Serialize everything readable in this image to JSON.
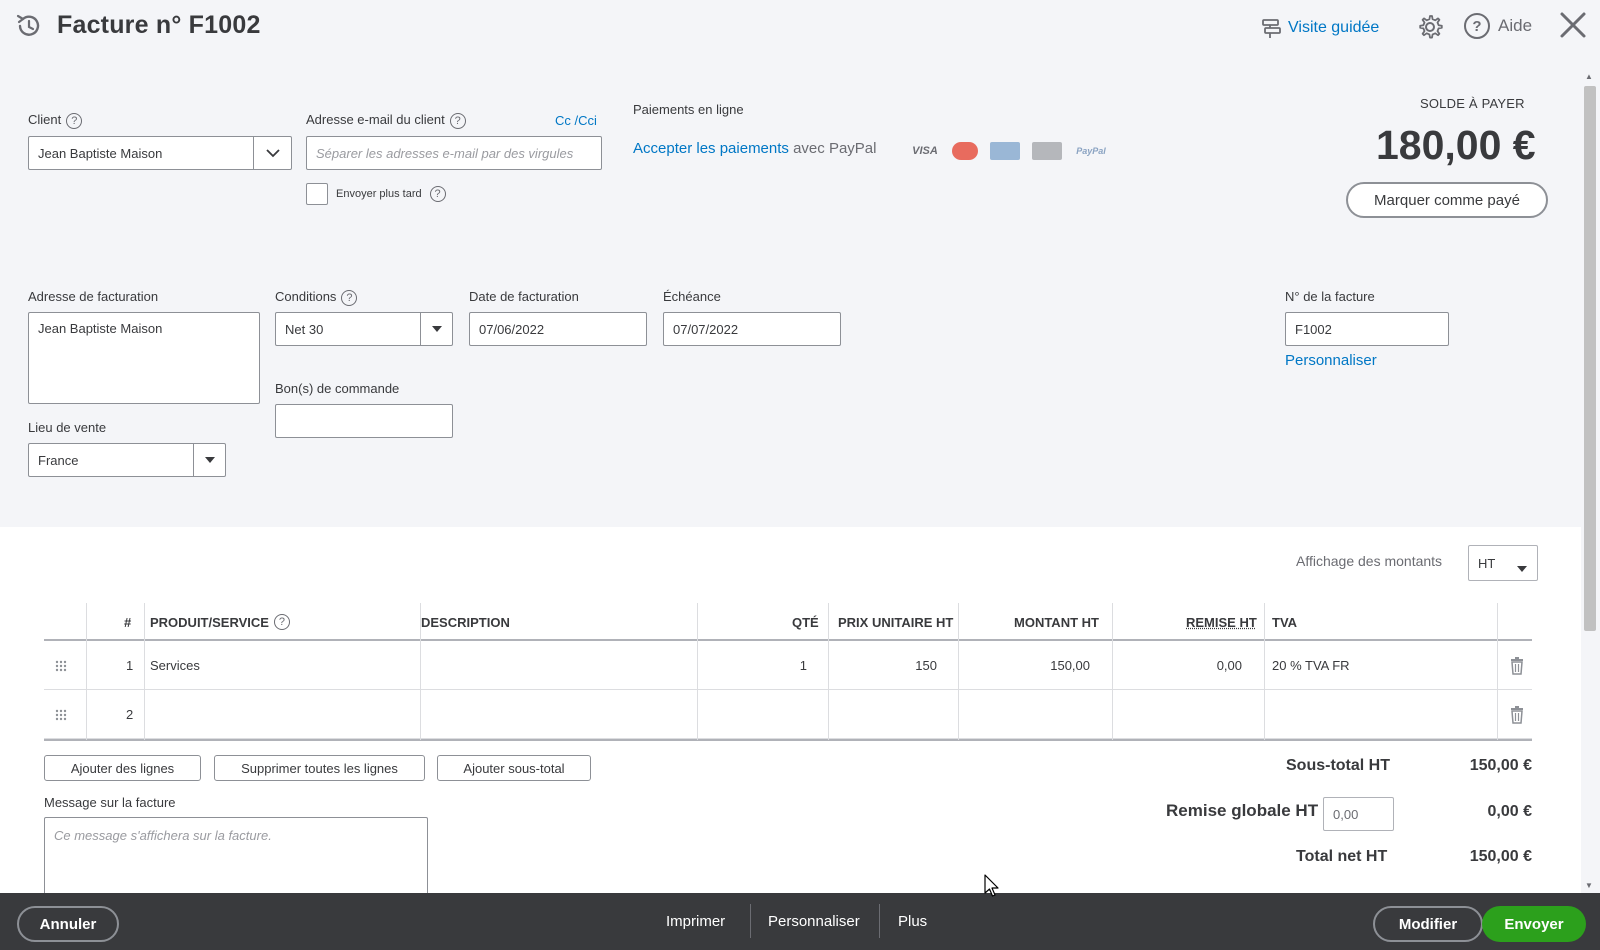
{
  "header": {
    "title": "Facture n° F1002",
    "guided_tour": "Visite guidée",
    "help": "Aide"
  },
  "client": {
    "label": "Client",
    "value": "Jean Baptiste Maison"
  },
  "email": {
    "label": "Adresse e-mail du client",
    "cc": "Cc /Cci",
    "placeholder": "Séparer les adresses e-mail par des virgules",
    "send_later": "Envoyer plus tard"
  },
  "online_payments": {
    "label": "Paiements en ligne",
    "link": "Accepter les paiements",
    "suffix": " avec PayPal",
    "cards": [
      "VISA",
      "MC",
      "AMEX",
      "CB",
      "PayPal"
    ]
  },
  "balance": {
    "label": "SOLDE À PAYER",
    "amount": "180,00 €",
    "mark_paid": "Marquer comme payé"
  },
  "billing": {
    "address_label": "Adresse de facturation",
    "address_value": "Jean Baptiste Maison",
    "terms_label": "Conditions",
    "terms_value": "Net 30",
    "invoice_date_label": "Date de facturation",
    "invoice_date_value": "07/06/2022",
    "due_label": "Échéance",
    "due_value": "07/07/2022",
    "po_label": "Bon(s) de commande",
    "po_value": "",
    "place_label": "Lieu de vente",
    "place_value": "France",
    "invoice_no_label": "N° de la facture",
    "invoice_no_value": "F1002",
    "customize": "Personnaliser"
  },
  "amounts_display": {
    "label": "Affichage des montants",
    "value": "HT"
  },
  "table": {
    "headers": {
      "num": "#",
      "product": "PRODUIT/SERVICE",
      "description": "DESCRIPTION",
      "qty": "QTÉ",
      "unit_price": "PRIX UNITAIRE HT",
      "amount": "MONTANT HT",
      "discount": "REMISE HT",
      "vat": "TVA"
    },
    "rows": [
      {
        "num": "1",
        "product": "Services",
        "description": "",
        "qty": "1",
        "unit_price": "150",
        "amount": "150,00",
        "discount": "0,00",
        "vat": "20 % TVA FR"
      },
      {
        "num": "2",
        "product": "",
        "description": "",
        "qty": "",
        "unit_price": "",
        "amount": "",
        "discount": "",
        "vat": ""
      }
    ]
  },
  "actions": {
    "add_lines": "Ajouter des lignes",
    "delete_all": "Supprimer toutes les lignes",
    "add_subtotal": "Ajouter sous-total"
  },
  "message": {
    "label": "Message sur la facture",
    "placeholder": "Ce message s'affichera sur la facture."
  },
  "totals": {
    "subtotal_label": "Sous-total HT",
    "subtotal_value": "150,00 €",
    "discount_label": "Remise globale HT",
    "discount_input": "0,00",
    "discount_value": "0,00 €",
    "net_label": "Total net HT",
    "net_value": "150,00 €"
  },
  "footer": {
    "cancel": "Annuler",
    "print": "Imprimer",
    "customize": "Personnaliser",
    "more": "Plus",
    "edit": "Modifier",
    "send": "Envoyer"
  }
}
